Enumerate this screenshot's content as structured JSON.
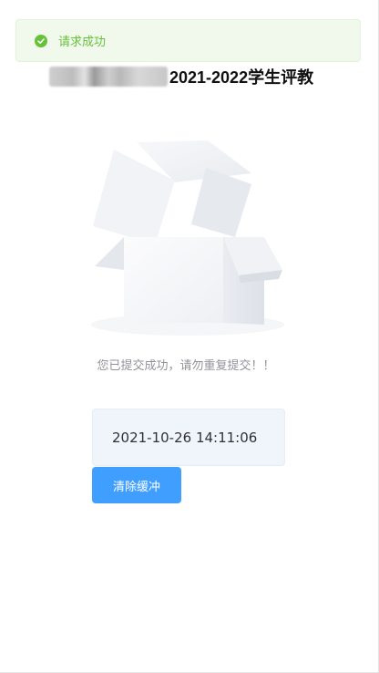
{
  "toast": {
    "icon": "success-check-icon",
    "message": "请求成功",
    "color": "#67c23a"
  },
  "header": {
    "title": "2021-2022学生评教"
  },
  "empty": {
    "illustration": "empty-box-icon",
    "message": "您已提交成功，请勿重复提交！！"
  },
  "submission": {
    "timestamp": "2021-10-26 14:11:06"
  },
  "actions": {
    "clear_cache_label": "清除缓冲",
    "button_color": "#409eff"
  }
}
